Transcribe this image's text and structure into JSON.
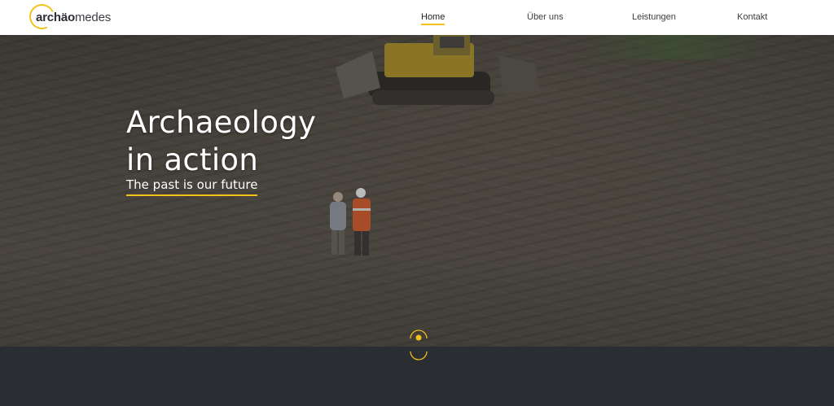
{
  "brand": {
    "logo_prefix": "archäo",
    "logo_suffix": "medes"
  },
  "nav": {
    "items": [
      {
        "label": "Home",
        "active": true
      },
      {
        "label": "Über uns",
        "active": false
      },
      {
        "label": "Leistungen",
        "active": false
      },
      {
        "label": "Kontakt",
        "active": false
      }
    ]
  },
  "hero": {
    "title_line1": "Archaeology",
    "title_line2": "in action",
    "subtitle": "The past is our future"
  },
  "colors": {
    "accent": "#f2c21b",
    "dark": "#2a2d31",
    "header_bg": "#ffffff"
  }
}
